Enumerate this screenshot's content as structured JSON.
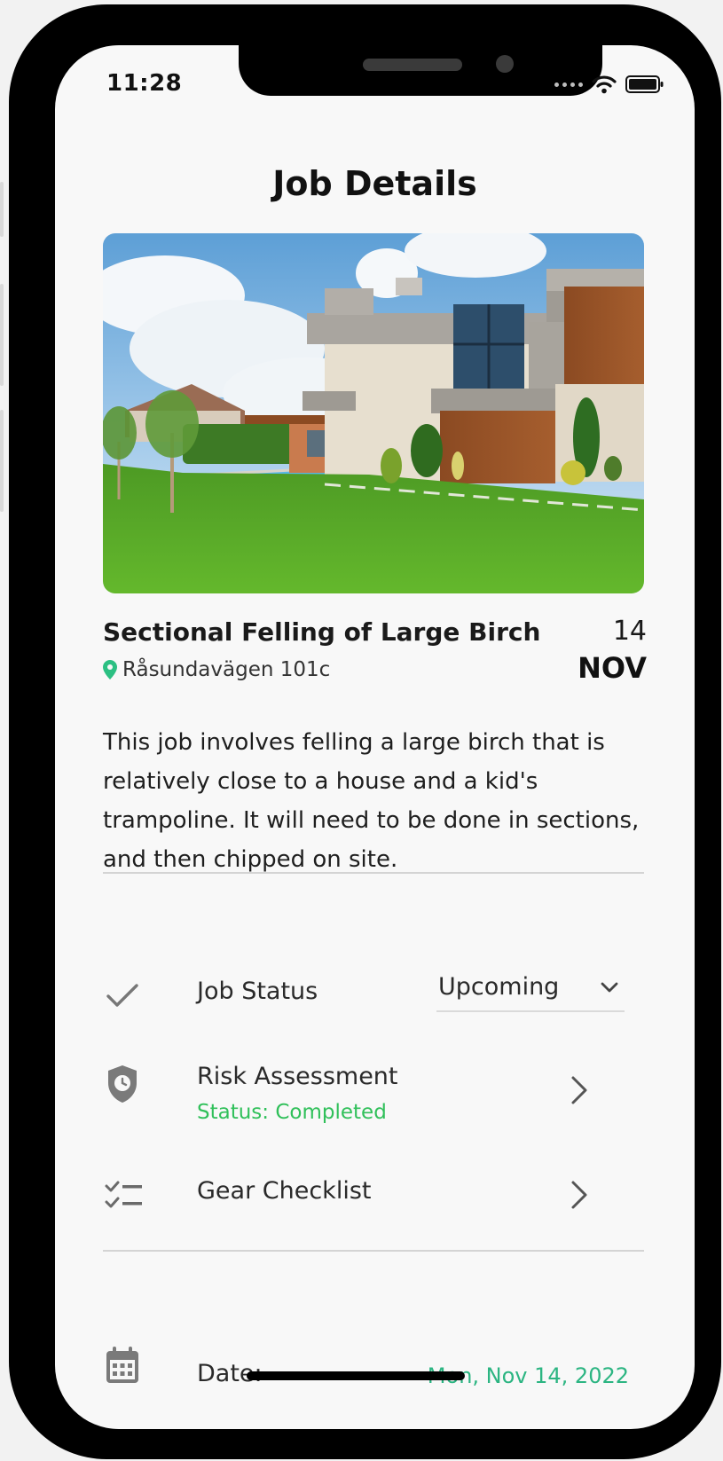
{
  "status_bar": {
    "time": "11:28"
  },
  "header": {
    "title": "Job Details"
  },
  "hero_image": {
    "description": "Modern two-storey house with lawn and pool"
  },
  "job": {
    "name": "Sectional Felling of Large Birch",
    "address": "Råsundavägen 101c",
    "day": "14",
    "month": "NOV",
    "description": "This job involves felling a large birch that is relatively close to a house and a kid's trampoline. It will need to be done in sections, and then chipped on site."
  },
  "rows": {
    "job_status": {
      "label": "Job Status",
      "value": "Upcoming",
      "icon": "checkmark-icon"
    },
    "risk_assessment": {
      "label": "Risk Assessment",
      "status": "Status: Completed",
      "icon": "shield-clock-icon"
    },
    "gear_checklist": {
      "label": "Gear Checklist",
      "icon": "checklist-icon"
    },
    "date": {
      "label": "Date:",
      "value": "Mon, Nov 14, 2022",
      "icon": "calendar-icon"
    }
  },
  "colors": {
    "accent_green": "#30c05a",
    "date_green": "#2cb582",
    "pin_green": "#2cc083"
  }
}
